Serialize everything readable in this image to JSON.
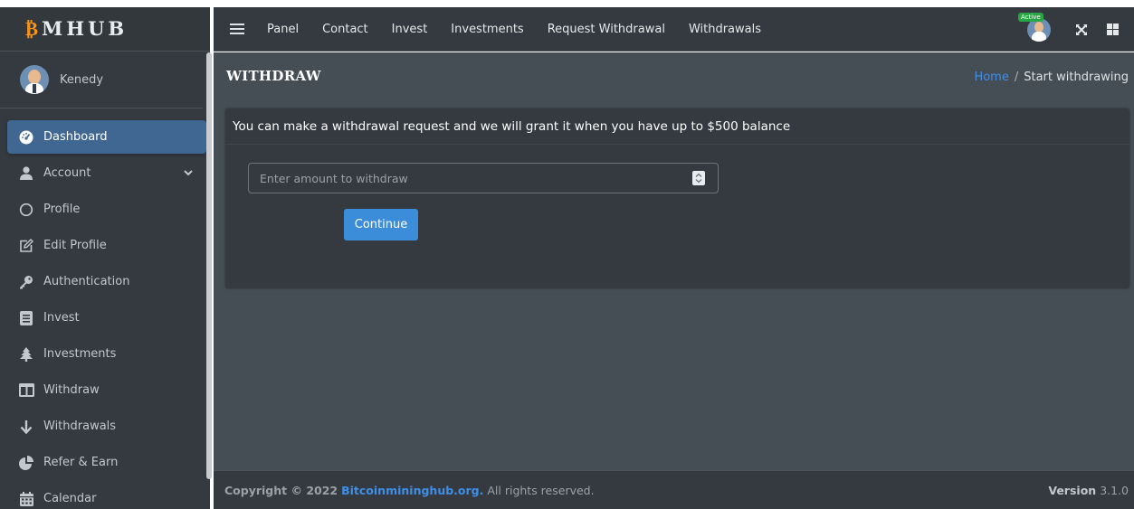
{
  "brand": {
    "btc": "₿",
    "rest": "MHUB"
  },
  "user": {
    "name": "Kenedy"
  },
  "sidebar": {
    "items": [
      {
        "label": "Dashboard"
      },
      {
        "label": "Account"
      },
      {
        "label": "Profile"
      },
      {
        "label": "Edit Profile"
      },
      {
        "label": "Authentication"
      },
      {
        "label": "Invest"
      },
      {
        "label": "Investments"
      },
      {
        "label": "Withdraw"
      },
      {
        "label": "Withdrawals"
      },
      {
        "label": "Refer & Earn"
      },
      {
        "label": "Calendar"
      }
    ]
  },
  "topbar": {
    "links": [
      "Panel",
      "Contact",
      "Invest",
      "Investments",
      "Request Withdrawal",
      "Withdrawals"
    ],
    "status": "Active"
  },
  "page": {
    "title": "WITHDRAW",
    "breadcrumb": {
      "home": "Home",
      "separator": "/",
      "current": "Start withdrawing"
    }
  },
  "withdraw": {
    "notice": "You can make a withdrawal request and we will grant it when you have up to $500 balance",
    "placeholder": "Enter amount to withdraw",
    "button": "Continue"
  },
  "footer": {
    "copyright": "Copyright © 2022",
    "site": "Bitcoinmininghub.org.",
    "rights": "All rights reserved.",
    "version_label": "Version",
    "version_number": "3.1.0"
  },
  "colors": {
    "sidebar_bg": "#343a40",
    "content_bg": "#454d55",
    "active_item": "#3f6791",
    "link_blue": "#3f8fe8",
    "button_blue": "#3c8dd9",
    "status_green": "#28a745",
    "bitcoin_orange": "#f7931a"
  }
}
